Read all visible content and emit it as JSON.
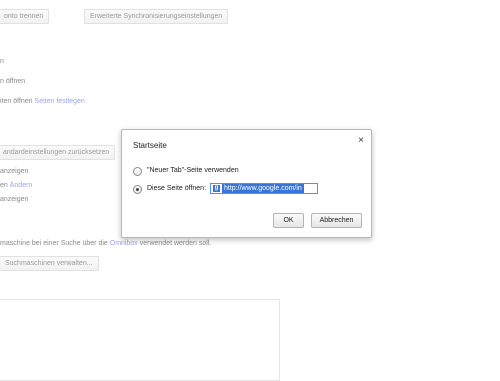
{
  "background": {
    "top_buttons": [
      "onto trennen",
      "Erweiterte Synchronisierungseinstellungen"
    ],
    "lines": [
      {
        "text": "n"
      },
      {
        "text": "n öffnen"
      },
      {
        "text": "iten öffnen",
        "link": "Seiten festlegen"
      },
      {
        "text": "anzeigen"
      },
      {
        "text": "en",
        "link": "Ändern"
      },
      {
        "text": "anzeigen"
      },
      {
        "text": "maschine bei einer Suche über die",
        "link": "Omnibox",
        "after": "verwendet werden soll."
      }
    ],
    "faded_button": "andardeinstellungen zurücksetzen",
    "search_engines_button": "Suchmaschinen verwalten..."
  },
  "dialog": {
    "title": "Startseite",
    "close": "×",
    "option_newtab": "\"Neuer Tab\"-Seite verwenden",
    "option_page": "Diese Seite öffnen:",
    "url_value": "http://www.google.com/in",
    "ok": "OK",
    "cancel": "Abbrechen"
  }
}
